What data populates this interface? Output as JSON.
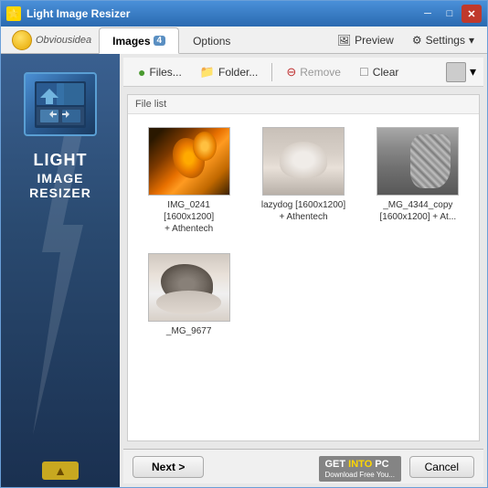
{
  "window": {
    "title": "Light Image Resizer",
    "minimize_label": "─",
    "maximize_label": "□",
    "close_label": "✕"
  },
  "logo": {
    "text": "Obviousidea",
    "bulb": "💡"
  },
  "tabs": [
    {
      "id": "images",
      "label": "Images",
      "badge": "4",
      "active": true
    },
    {
      "id": "options",
      "label": "Options",
      "active": false
    }
  ],
  "menu_right": [
    {
      "id": "preview",
      "label": "Preview",
      "icon": "🖼"
    },
    {
      "id": "settings",
      "label": "Settings",
      "icon": "⚙"
    }
  ],
  "toolbar": {
    "files_btn": "Files...",
    "folder_btn": "Folder...",
    "remove_btn": "Remove",
    "clear_btn": "Clear"
  },
  "file_list": {
    "header": "File list",
    "items": [
      {
        "id": 1,
        "thumb_class": "thumb-1",
        "name": "IMG_0241\n[1600x1200]\n+ Athentech"
      },
      {
        "id": 2,
        "thumb_class": "thumb-2",
        "name": "lazydog [1600x1200]\n+ Athentech"
      },
      {
        "id": 3,
        "thumb_class": "thumb-3",
        "name": "_MG_4344_copy\n[1600x1200] + At..."
      },
      {
        "id": 4,
        "thumb_class": "thumb-4",
        "name": "_MG_9677"
      }
    ]
  },
  "sidebar": {
    "title_line1": "LIGHT",
    "title_line2": "IMAGE",
    "title_line3": "RESIZER"
  },
  "bottom": {
    "next_label": "Next >",
    "cancel_label": "Cancel",
    "watermark": "GET INTO PC\nDownload Free You..."
  }
}
